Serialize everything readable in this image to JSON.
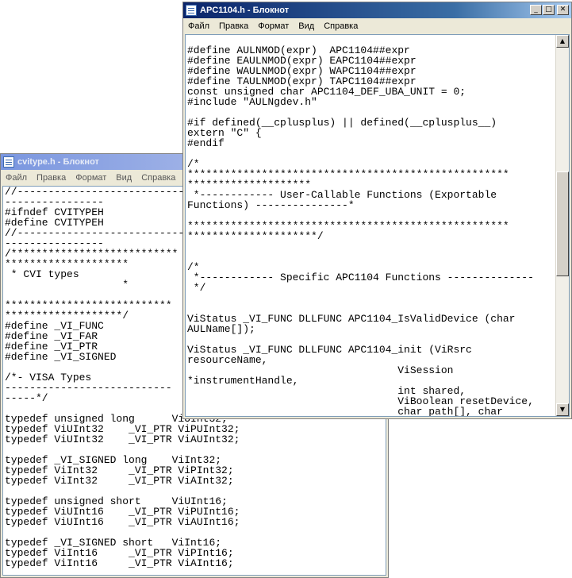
{
  "windows": {
    "back": {
      "title": "cvitype.h - Блокнот",
      "menu": [
        "Файл",
        "Правка",
        "Формат",
        "Вид",
        "Справка"
      ],
      "content": "//---------------------------\n----------------\n#ifndef CVITYPEH\n#define CVITYPEH\n//---------------------------\n----------------\n/***************************\n********************\n * CVI types\n                   *\n\n***************************\n*******************/\n#define _VI_FUNC\n#define _VI_FAR\n#define _VI_PTR\n#define _VI_SIGNED\n\n/*- VISA Types\n---------------------------\n-----*/\n\ntypedef unsigned long      ViUInt32;\ntypedef ViUInt32    _VI_PTR ViPUInt32;\ntypedef ViUInt32    _VI_PTR ViAUInt32;\n\ntypedef _VI_SIGNED long    ViInt32;\ntypedef ViInt32     _VI_PTR ViPInt32;\ntypedef ViInt32     _VI_PTR ViAInt32;\n\ntypedef unsigned short     ViUInt16;\ntypedef ViUInt16    _VI_PTR ViPUInt16;\ntypedef ViUInt16    _VI_PTR ViAUInt16;\n\ntypedef _VI_SIGNED short   ViInt16;\ntypedef ViInt16     _VI_PTR ViPInt16;\ntypedef ViInt16     _VI_PTR ViAInt16;"
    },
    "front": {
      "title": "APC1104.h - Блокнот",
      "menu": [
        "Файл",
        "Правка",
        "Формат",
        "Вид",
        "Справка"
      ],
      "content": "\n#define AULNMOD(expr)  APC1104##expr\n#define EAULNMOD(expr) EAPC1104##expr\n#define WAULNMOD(expr) WAPC1104##expr\n#define TAULNMOD(expr) TAPC1104##expr\nconst unsigned char APC1104_DEF_UBA_UNIT = 0;\n#include \"AULNgdev.h\"\n\n#if defined(__cplusplus) || defined(__cplusplus__)\nextern \"C\" {\n#endif\n\n/*\n****************************************************\n********************\n *------------ User-Callable Functions (Exportable\nFunctions) ---------------*\n\n****************************************************\n*********************/\n\n\n/*\n *------------ Specific APC1104 Functions --------------\n */\n\n\nViStatus _VI_FUNC DLLFUNC APC1104_IsValidDevice (char\nAULName[]);\n\nViStatus _VI_FUNC DLLFUNC APC1104_init (ViRsrc\nresourceName,\n                                  ViSession\n*instrumentHandle,\n                                  int shared,\n                                  ViBoolean resetDevice,\n                                  char path[], char\nAULDevName[], DWORD *Plugins);"
    }
  },
  "icons": {
    "app": "notepad-icon",
    "minimize": "minimize-icon",
    "maximize": "maximize-icon",
    "close": "close-icon",
    "scroll_up": "scroll-up-icon",
    "scroll_down": "scroll-down-icon"
  },
  "colors": {
    "active_title": "#0a246a",
    "inactive_title": "#7a96df",
    "chrome": "#ece9d8",
    "editor_bg": "#ffffff"
  }
}
